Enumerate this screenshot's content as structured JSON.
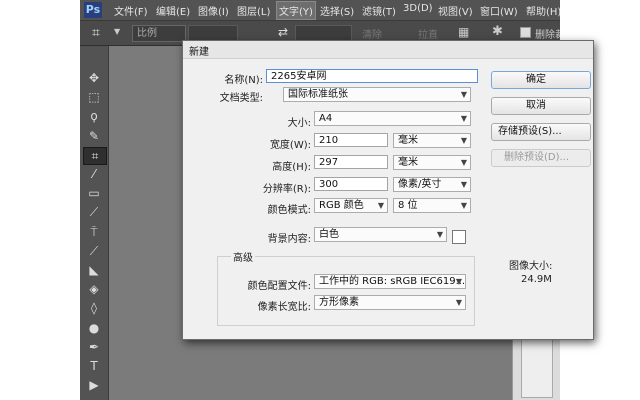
{
  "app": {
    "logo": "Ps",
    "menu": [
      "文件(F)",
      "编辑(E)",
      "图像(I)",
      "图层(L)",
      "文字(Y)",
      "选择(S)",
      "滤镜(T)",
      "3D(D)",
      "视图(V)",
      "窗口(W)",
      "帮助(H)"
    ],
    "active_menu_index": 4
  },
  "options_bar": {
    "ratio": "比例",
    "clear": "清除",
    "straighten": "拉直",
    "delete_cropped": "删除裁"
  },
  "toolbar": {
    "tools": [
      "move-icon",
      "marquee-icon",
      "lasso-icon",
      "quick-select-icon",
      "crop-icon",
      "eyedropper-icon",
      "healing-icon",
      "brush-icon",
      "stamp-icon",
      "history-brush-icon",
      "eraser-icon",
      "paint-bucket-icon",
      "blur-icon",
      "dodge-icon",
      "pen-icon",
      "type-icon",
      "path-select-icon"
    ],
    "glyphs": [
      "✥",
      "⬚",
      "ϙ",
      "✎",
      "⌗",
      "⁄",
      "▭",
      "⟋",
      "⍑",
      "⟋",
      "◣",
      "◈",
      "◊",
      "●",
      "✒",
      "T",
      "▶"
    ],
    "active_index": 4
  },
  "dialog": {
    "title": "新建",
    "name_label": "名称(N):",
    "name_value": "2265安卓网",
    "doc_type_label": "文档类型:",
    "doc_type_value": "国际标准纸张",
    "size_label": "大小:",
    "size_value": "A4",
    "width_label": "宽度(W):",
    "width_value": "210",
    "width_unit": "毫米",
    "height_label": "高度(H):",
    "height_value": "297",
    "height_unit": "毫米",
    "resolution_label": "分辨率(R):",
    "resolution_value": "300",
    "resolution_unit": "像素/英寸",
    "color_mode_label": "颜色模式:",
    "color_mode_value": "RGB 颜色",
    "bit_depth_value": "8 位",
    "bg_label": "背景内容:",
    "bg_value": "白色",
    "advanced_label": "高级",
    "profile_label": "颜色配置文件:",
    "profile_value": "工作中的 RGB: sRGB IEC619...",
    "pixel_aspect_label": "像素长宽比:",
    "pixel_aspect_value": "方形像素",
    "ok_label": "确定",
    "cancel_label": "取消",
    "save_preset_label": "存储预设(S)...",
    "delete_preset_label": "删除预设(D)...",
    "image_size_label": "图像大小:",
    "image_size_value": "24.9M"
  }
}
